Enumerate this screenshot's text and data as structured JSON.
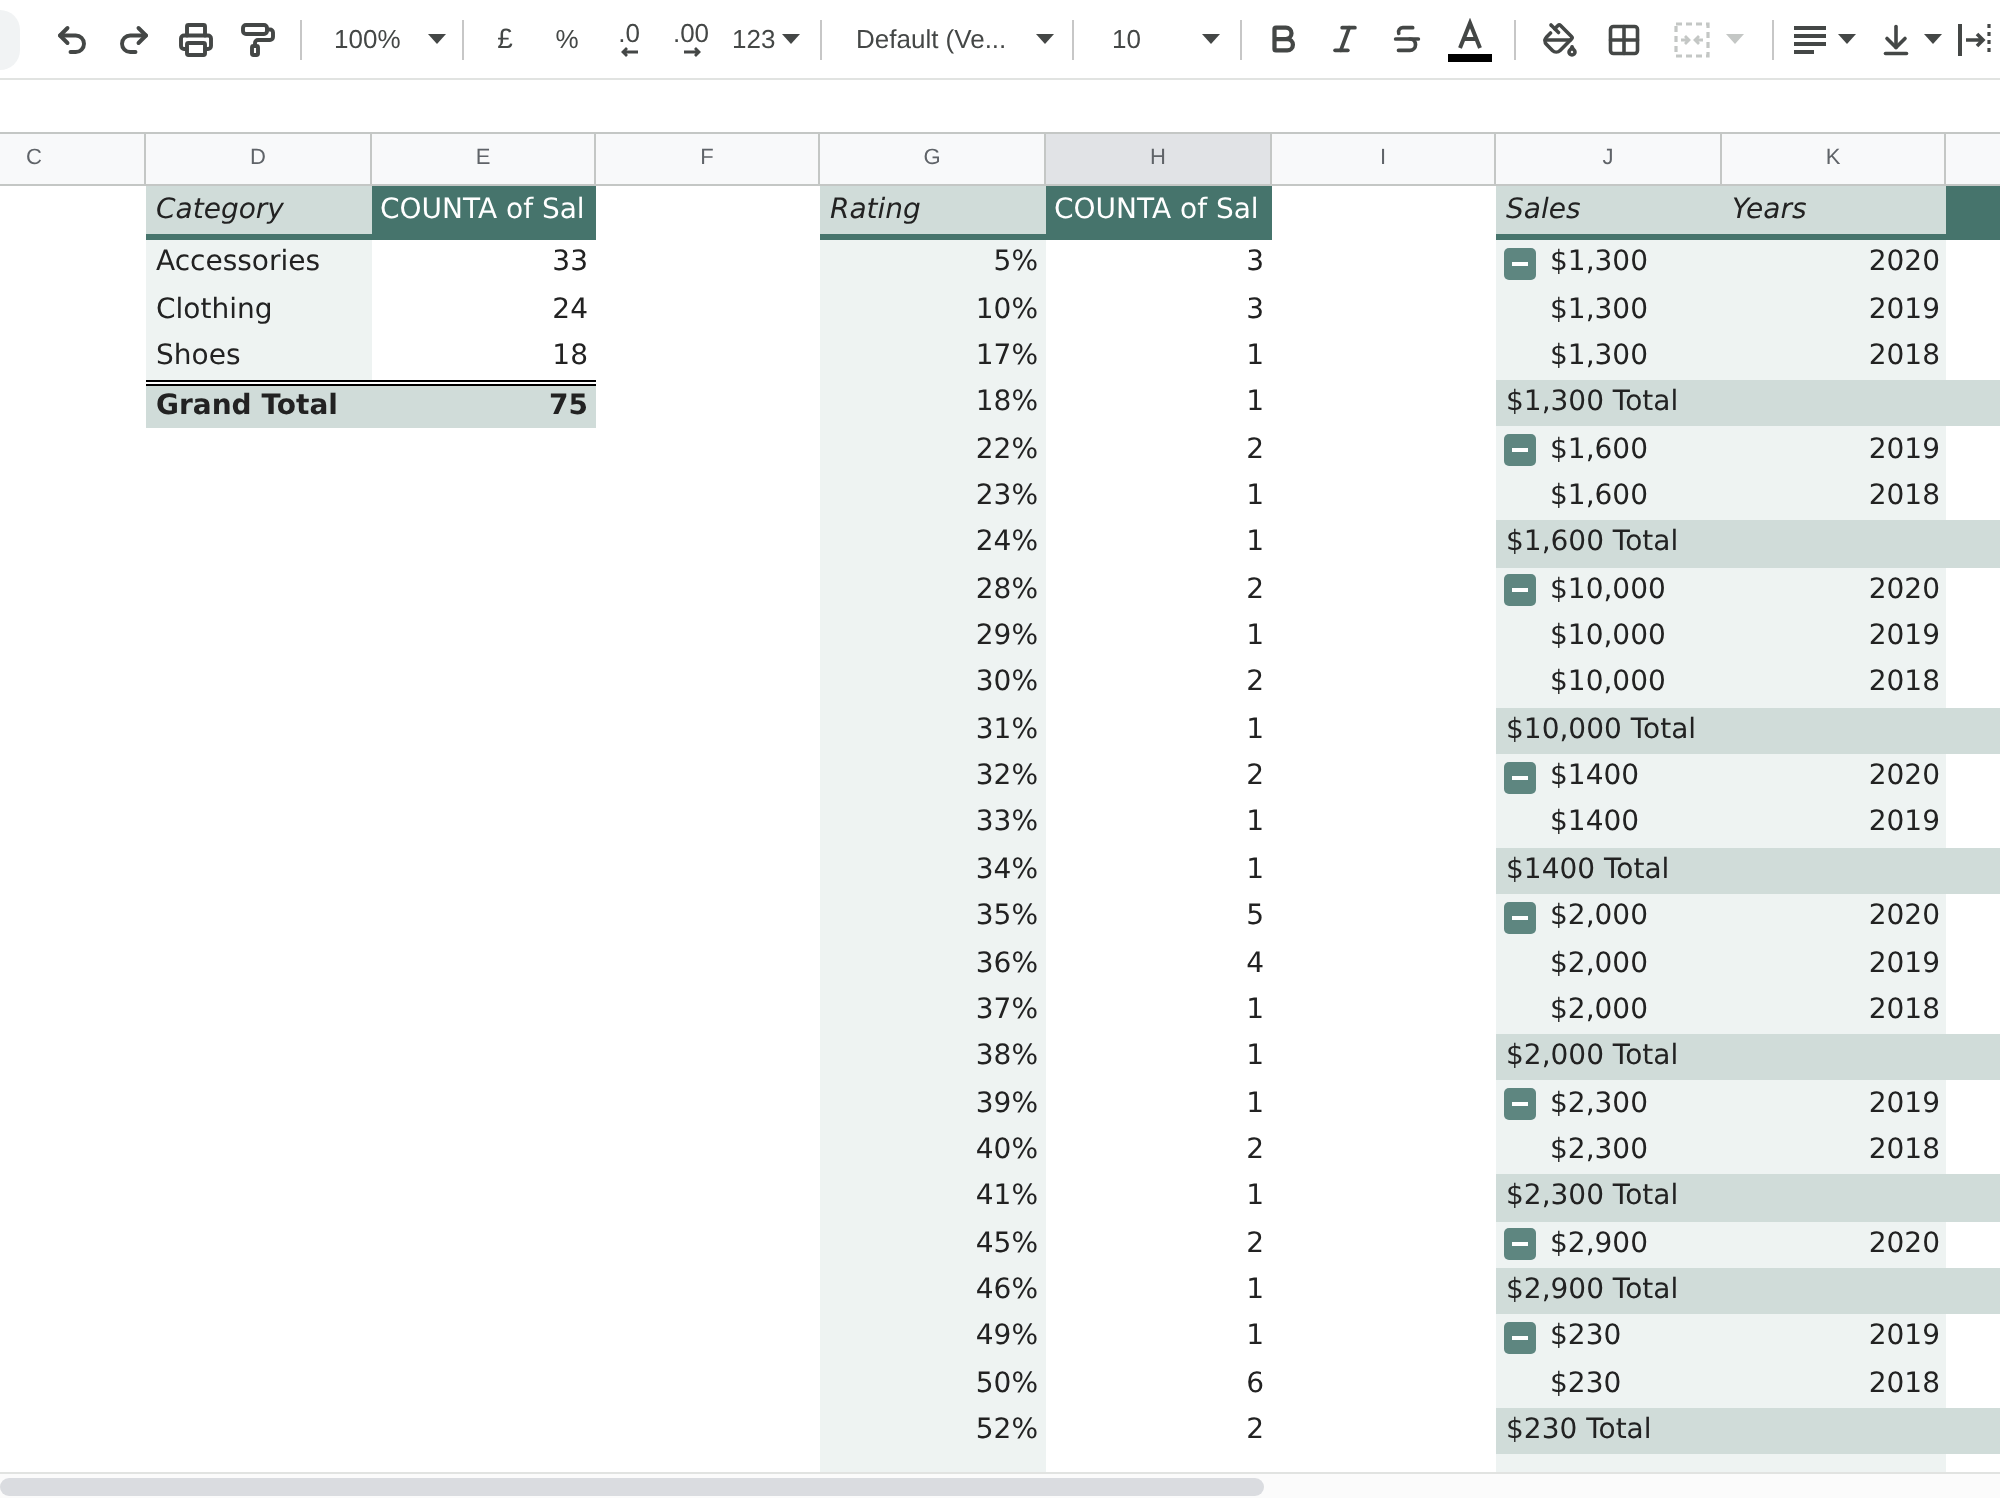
{
  "toolbar": {
    "zoom": "100%",
    "currency": "£",
    "percent": "%",
    "decrease_decimal": ".0",
    "increase_decimal": ".00",
    "more_formats": "123",
    "font": "Default (Ve...",
    "font_size": "10",
    "merge": {
      "disabled": true
    }
  },
  "column_headers": [
    {
      "label": "C",
      "selected": false
    },
    {
      "label": "D",
      "selected": false
    },
    {
      "label": "E",
      "selected": false
    },
    {
      "label": "F",
      "selected": false
    },
    {
      "label": "G",
      "selected": false
    },
    {
      "label": "H",
      "selected": true
    },
    {
      "label": "I",
      "selected": false
    },
    {
      "label": "J",
      "selected": false
    },
    {
      "label": "K",
      "selected": false
    }
  ],
  "pivot_category": {
    "columns": [
      "Category",
      "COUNTA of Sal"
    ],
    "rows": [
      {
        "label": "Accessories",
        "value": "33"
      },
      {
        "label": "Clothing",
        "value": "24"
      },
      {
        "label": "Shoes",
        "value": "18"
      }
    ],
    "total": {
      "label": "Grand Total",
      "value": "75"
    }
  },
  "pivot_rating": {
    "columns": [
      "Rating",
      "COUNTA of Sal"
    ],
    "rows": [
      {
        "label": "5%",
        "value": "3"
      },
      {
        "label": "10%",
        "value": "3"
      },
      {
        "label": "17%",
        "value": "1"
      },
      {
        "label": "18%",
        "value": "1"
      },
      {
        "label": "22%",
        "value": "2"
      },
      {
        "label": "23%",
        "value": "1"
      },
      {
        "label": "24%",
        "value": "1"
      },
      {
        "label": "28%",
        "value": "2"
      },
      {
        "label": "29%",
        "value": "1"
      },
      {
        "label": "30%",
        "value": "2"
      },
      {
        "label": "31%",
        "value": "1"
      },
      {
        "label": "32%",
        "value": "2"
      },
      {
        "label": "33%",
        "value": "1"
      },
      {
        "label": "34%",
        "value": "1"
      },
      {
        "label": "35%",
        "value": "5"
      },
      {
        "label": "36%",
        "value": "4"
      },
      {
        "label": "37%",
        "value": "1"
      },
      {
        "label": "38%",
        "value": "1"
      },
      {
        "label": "39%",
        "value": "1"
      },
      {
        "label": "40%",
        "value": "2"
      },
      {
        "label": "41%",
        "value": "1"
      },
      {
        "label": "45%",
        "value": "2"
      },
      {
        "label": "46%",
        "value": "1"
      },
      {
        "label": "49%",
        "value": "1"
      },
      {
        "label": "50%",
        "value": "6"
      },
      {
        "label": "52%",
        "value": "2"
      }
    ]
  },
  "pivot_sales": {
    "columns": [
      "Sales",
      "Years"
    ],
    "groups": [
      {
        "expanded": true,
        "rows": [
          {
            "sales": "$1,300",
            "year": "2020"
          },
          {
            "sales": "$1,300",
            "year": "2019"
          },
          {
            "sales": "$1,300",
            "year": "2018"
          }
        ],
        "total": "$1,300 Total"
      },
      {
        "expanded": true,
        "rows": [
          {
            "sales": "$1,600",
            "year": "2019"
          },
          {
            "sales": "$1,600",
            "year": "2018"
          }
        ],
        "total": "$1,600 Total"
      },
      {
        "expanded": true,
        "rows": [
          {
            "sales": "$10,000",
            "year": "2020"
          },
          {
            "sales": "$10,000",
            "year": "2019"
          },
          {
            "sales": "$10,000",
            "year": "2018"
          }
        ],
        "total": "$10,000 Total"
      },
      {
        "expanded": true,
        "rows": [
          {
            "sales": "$1400",
            "year": "2020"
          },
          {
            "sales": "$1400",
            "year": "2019"
          }
        ],
        "total": "$1400 Total"
      },
      {
        "expanded": true,
        "rows": [
          {
            "sales": "$2,000",
            "year": "2020"
          },
          {
            "sales": "$2,000",
            "year": "2019"
          },
          {
            "sales": "$2,000",
            "year": "2018"
          }
        ],
        "total": "$2,000 Total"
      },
      {
        "expanded": true,
        "rows": [
          {
            "sales": "$2,300",
            "year": "2019"
          },
          {
            "sales": "$2,300",
            "year": "2018"
          }
        ],
        "total": "$2,300 Total"
      },
      {
        "expanded": true,
        "rows": [
          {
            "sales": "$2,900",
            "year": "2020"
          }
        ],
        "total": "$2,900 Total"
      },
      {
        "expanded": true,
        "rows": [
          {
            "sales": "$230",
            "year": "2019"
          },
          {
            "sales": "$230",
            "year": "2018"
          }
        ],
        "total": "$230 Total"
      }
    ]
  }
}
